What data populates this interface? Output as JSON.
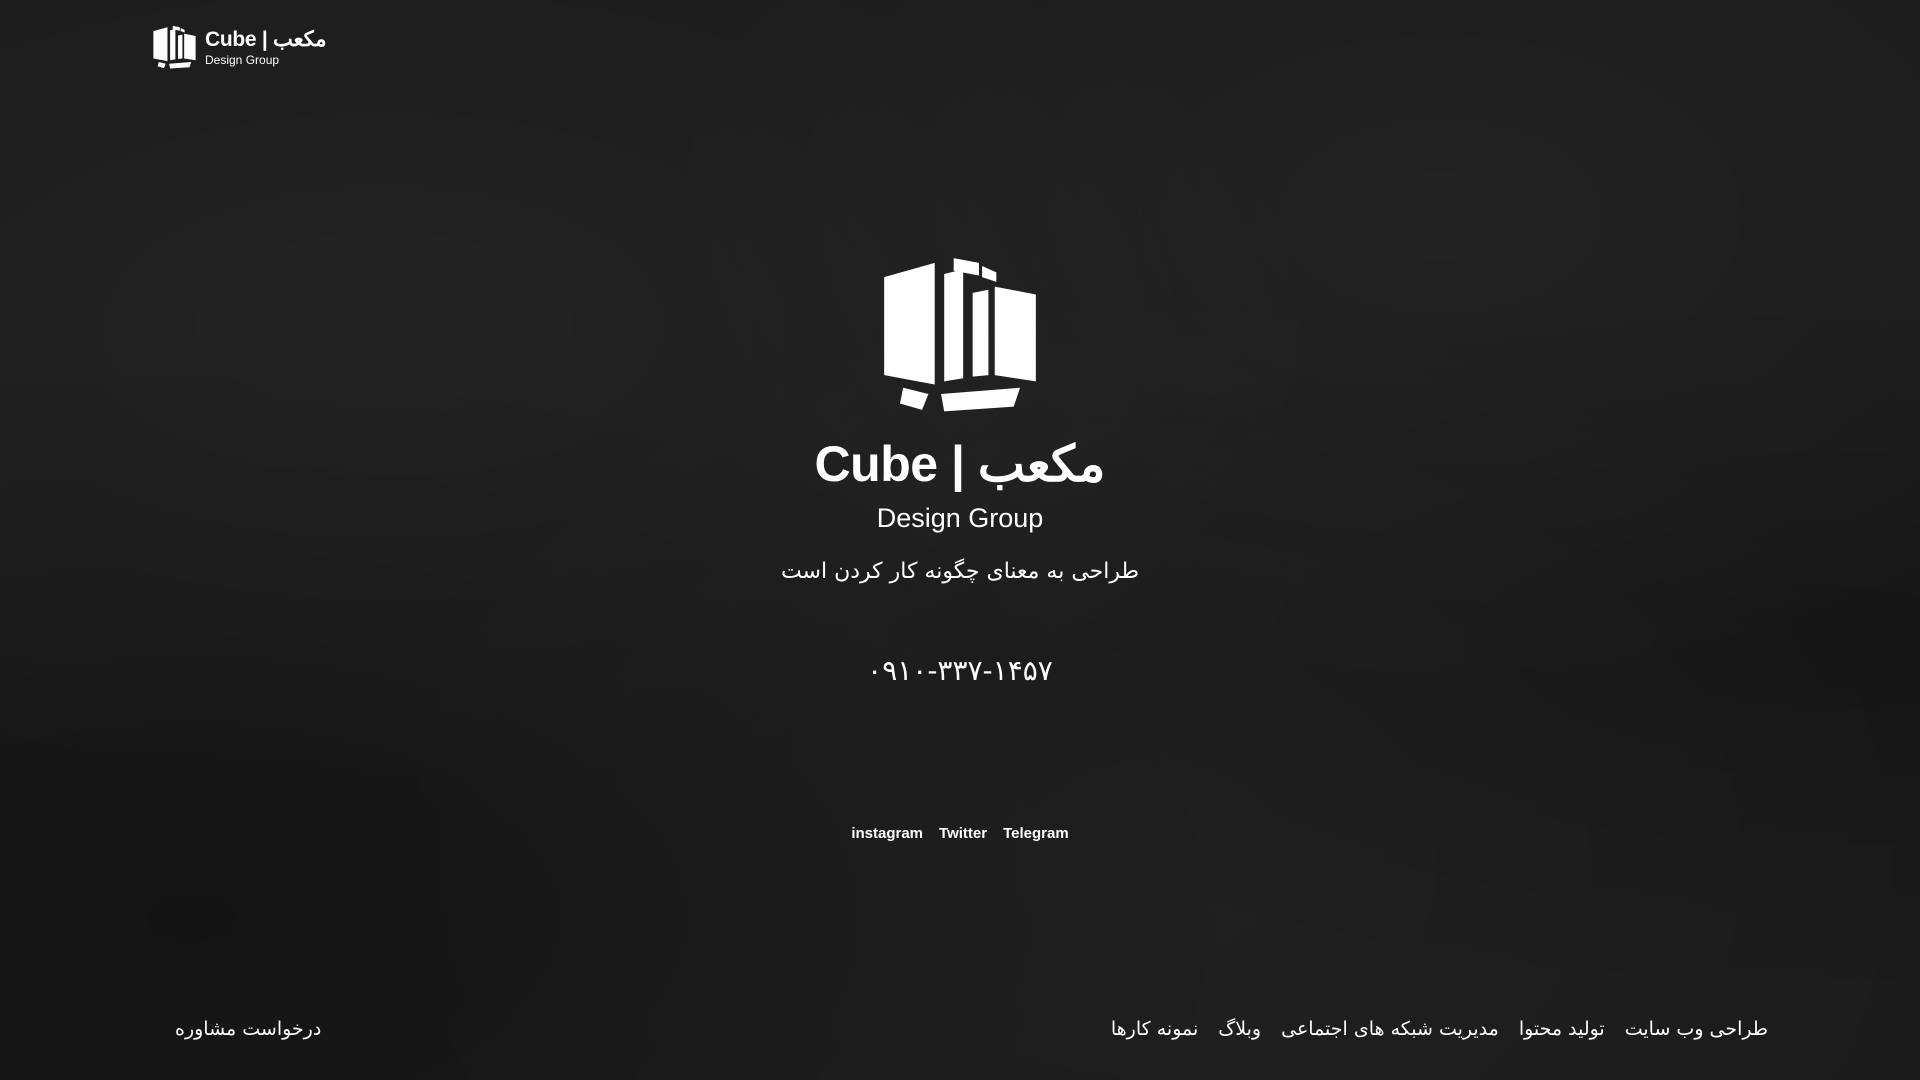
{
  "header": {
    "logo_name": "Cube | مکعب",
    "logo_sub": "Design Group"
  },
  "hero": {
    "brand_title": "Cube | مکعب",
    "brand_subtitle": "Design Group",
    "tagline": "طراحی به معنای چگونه کار کردن است",
    "phone": "۰۹۱۰-۳۳۷-۱۴۵۷"
  },
  "social": {
    "instagram": "instagram",
    "twitter": "Twitter",
    "telegram": "Telegram"
  },
  "footer": {
    "nav": [
      {
        "label": "طراحی وب سایت"
      },
      {
        "label": "تولید محتوا"
      },
      {
        "label": "مدیریت شبکه های اجتماعی"
      },
      {
        "label": "وبلاگ"
      },
      {
        "label": "نمونه کارها"
      }
    ],
    "consult": "درخواست مشاوره"
  },
  "colors": {
    "background": "#1b1b1b",
    "foreground": "#ffffff"
  },
  "icons": {
    "logo": "cube-logo-icon"
  }
}
